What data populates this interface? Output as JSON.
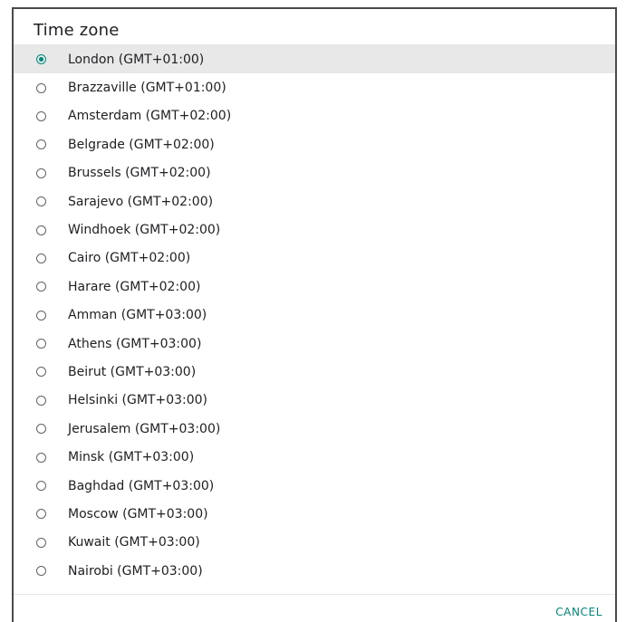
{
  "dialog": {
    "title": "Time zone",
    "cancel_label": "CANCEL",
    "accent_color": "#00897b",
    "selected_index": 0,
    "options": [
      {
        "label": "London (GMT+01:00)",
        "selected": true
      },
      {
        "label": "Brazzaville (GMT+01:00)",
        "selected": false
      },
      {
        "label": "Amsterdam (GMT+02:00)",
        "selected": false
      },
      {
        "label": "Belgrade (GMT+02:00)",
        "selected": false
      },
      {
        "label": "Brussels (GMT+02:00)",
        "selected": false
      },
      {
        "label": "Sarajevo (GMT+02:00)",
        "selected": false
      },
      {
        "label": "Windhoek (GMT+02:00)",
        "selected": false
      },
      {
        "label": "Cairo (GMT+02:00)",
        "selected": false
      },
      {
        "label": "Harare (GMT+02:00)",
        "selected": false
      },
      {
        "label": "Amman (GMT+03:00)",
        "selected": false
      },
      {
        "label": "Athens (GMT+03:00)",
        "selected": false
      },
      {
        "label": "Beirut (GMT+03:00)",
        "selected": false
      },
      {
        "label": "Helsinki (GMT+03:00)",
        "selected": false
      },
      {
        "label": "Jerusalem (GMT+03:00)",
        "selected": false
      },
      {
        "label": "Minsk (GMT+03:00)",
        "selected": false
      },
      {
        "label": "Baghdad (GMT+03:00)",
        "selected": false
      },
      {
        "label": "Moscow (GMT+03:00)",
        "selected": false
      },
      {
        "label": "Kuwait (GMT+03:00)",
        "selected": false
      },
      {
        "label": "Nairobi (GMT+03:00)",
        "selected": false
      }
    ]
  }
}
